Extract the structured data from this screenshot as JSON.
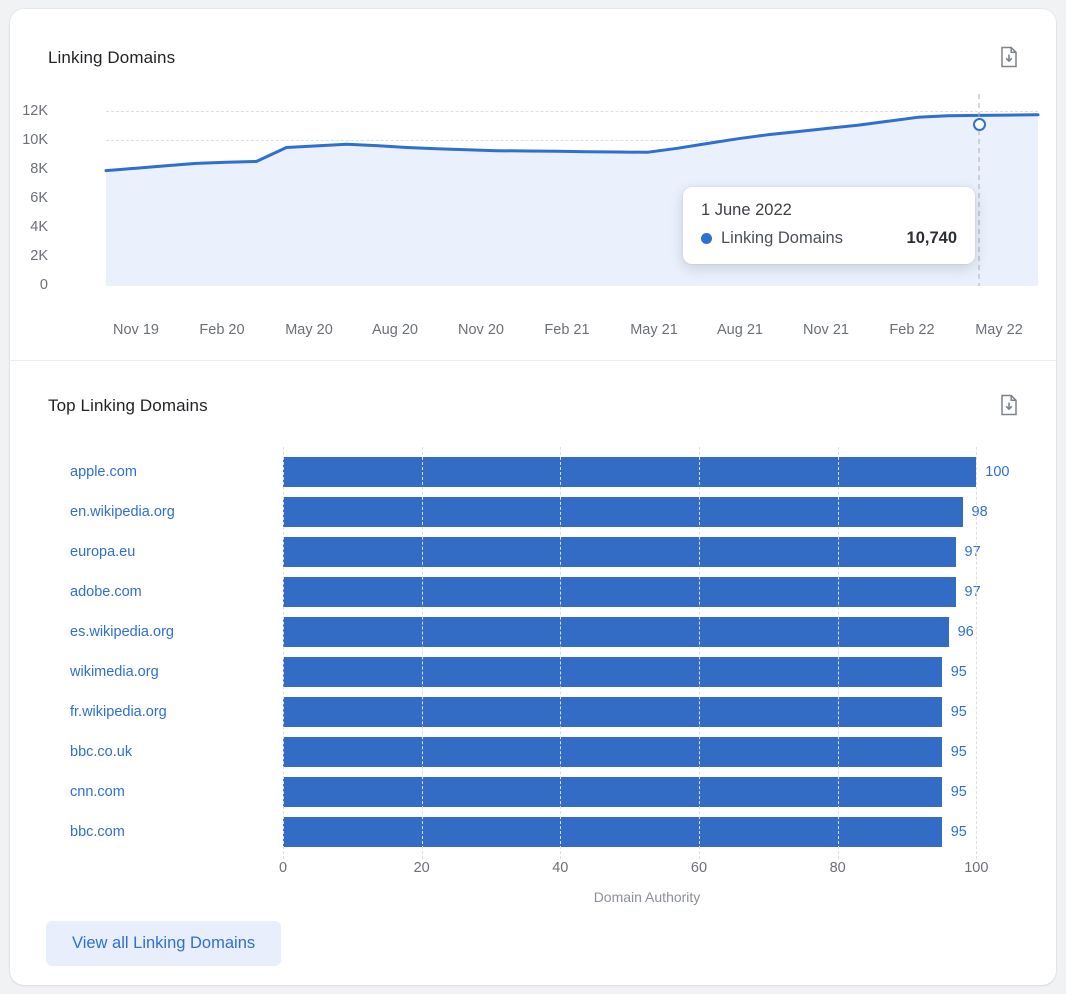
{
  "linking_domains": {
    "title": "Linking Domains",
    "export_icon": "document-download-icon",
    "tooltip": {
      "date": "1 June 2022",
      "series_name": "Linking Domains",
      "value": "10,740"
    }
  },
  "top_linking_domains": {
    "title": "Top Linking Domains",
    "export_icon": "document-download-icon",
    "view_all_label": "View all Linking Domains"
  },
  "colors": {
    "line": "#2f6fd0",
    "area": "#eaf1fc",
    "bar": "#336CC4",
    "link": "#2f6fd0",
    "grid": "#dcdee2",
    "button_bg": "#e8eefb"
  },
  "chart_data": [
    {
      "type": "area",
      "title": "Linking Domains",
      "xlabel": "",
      "ylabel": "",
      "ylim": [
        0,
        12000
      ],
      "yticks": [
        "0",
        "2K",
        "4K",
        "6K",
        "8K",
        "10K",
        "12K"
      ],
      "ytick_values": [
        0,
        2000,
        4000,
        6000,
        8000,
        10000,
        12000
      ],
      "xticks": [
        "Nov 19",
        "Feb 20",
        "May 20",
        "Aug 20",
        "Nov 20",
        "Feb 21",
        "May 21",
        "Aug 21",
        "Nov 21",
        "Feb 22",
        "May 22"
      ],
      "grid": true,
      "legend": "none",
      "series": [
        {
          "name": "Linking Domains",
          "x": [
            "Nov 19",
            "Dec 19",
            "Jan 20",
            "Feb 20",
            "Mar 20",
            "Apr 20",
            "May 20",
            "Jun 20",
            "Jul 20",
            "Aug 20",
            "Sep 20",
            "Oct 20",
            "Nov 20",
            "Dec 20",
            "Jan 21",
            "Feb 21",
            "Mar 21",
            "Apr 21",
            "May 21",
            "Jun 21",
            "Jul 21",
            "Aug 21",
            "Sep 21",
            "Oct 21",
            "Nov 21",
            "Dec 21",
            "Jan 22",
            "Feb 22",
            "Mar 22",
            "Apr 22",
            "May 22",
            "Jun 22"
          ],
          "values": [
            7250,
            7400,
            7550,
            7700,
            7780,
            7820,
            8700,
            8800,
            8900,
            8820,
            8700,
            8620,
            8560,
            8500,
            8480,
            8460,
            8440,
            8420,
            8400,
            8650,
            8950,
            9250,
            9500,
            9700,
            9900,
            10100,
            10350,
            10600,
            10700,
            10720,
            10740,
            10760
          ]
        }
      ],
      "annotation": {
        "date": "1 June 2022",
        "label": "Linking Domains",
        "value": 10740
      }
    },
    {
      "type": "bar",
      "orientation": "horizontal",
      "title": "Top Linking Domains",
      "xlabel": "Domain Authority",
      "ylabel": "",
      "xlim": [
        0,
        105
      ],
      "xticks": [
        0,
        20,
        40,
        60,
        80,
        100
      ],
      "grid": true,
      "categories": [
        "apple.com",
        "en.wikipedia.org",
        "europa.eu",
        "adobe.com",
        "es.wikipedia.org",
        "wikimedia.org",
        "fr.wikipedia.org",
        "bbc.co.uk",
        "cnn.com",
        "bbc.com"
      ],
      "values": [
        100,
        98,
        97,
        97,
        96,
        95,
        95,
        95,
        95,
        95
      ],
      "value_labels": [
        "100",
        "98",
        "97",
        "97",
        "96",
        "95",
        "95",
        "95",
        "95",
        "95"
      ]
    }
  ]
}
